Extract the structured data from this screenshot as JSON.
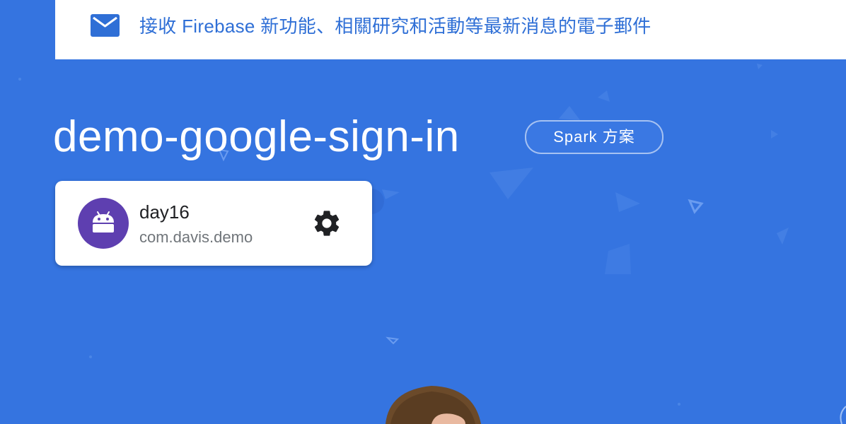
{
  "banner": {
    "icon": "mail-icon",
    "text": "接收 Firebase 新功能、相關研究和活動等最新消息的電子郵件"
  },
  "project": {
    "title": "demo-google-sign-in",
    "plan_badge": "Spark 方案"
  },
  "app_card": {
    "avatar_icon": "android-icon",
    "name": "day16",
    "package": "com.davis.demo",
    "settings_icon": "gear-icon"
  },
  "colors": {
    "background": "#3574e0",
    "banner_text": "#2f6fd6",
    "avatar": "#5e3fb0"
  }
}
